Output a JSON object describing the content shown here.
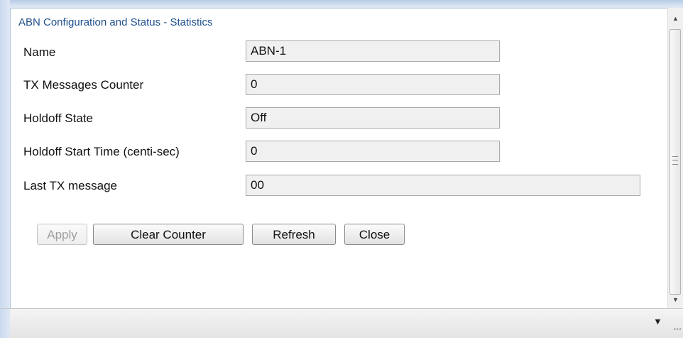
{
  "panel": {
    "title": "ABN Configuration and Status - Statistics"
  },
  "fields": [
    {
      "label": "Name",
      "value": "ABN-1"
    },
    {
      "label": "TX Messages Counter",
      "value": "0"
    },
    {
      "label": "Holdoff State",
      "value": "Off"
    },
    {
      "label": "Holdoff Start Time (centi-sec)",
      "value": "0"
    },
    {
      "label": "Last TX message",
      "value": "00"
    }
  ],
  "buttons": {
    "apply": "Apply",
    "clear_counter": "Clear Counter",
    "refresh": "Refresh",
    "close": "Close"
  },
  "icons": {
    "scroll_up": "up-arrow",
    "scroll_down": "down-arrow",
    "dropdown": "chevron-down",
    "resize": "resize-grip"
  },
  "colors": {
    "title": "#1f4f8c",
    "field_bg": "#f0f0f0",
    "frame": "#dce6f2"
  }
}
